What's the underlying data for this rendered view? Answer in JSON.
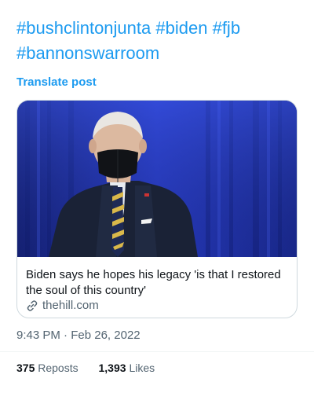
{
  "post": {
    "hashtags_line1": [
      "#bushclintonjunta",
      "#biden",
      "#fjb"
    ],
    "hashtags_line2": [
      "#bannonswarroom"
    ],
    "translate_label": "Translate post",
    "card": {
      "title": "Biden says he hopes his legacy 'is that I restored the soul of this country'",
      "domain": "thehill.com",
      "image_icon": "link-icon"
    },
    "time": "9:43 PM",
    "separator": "·",
    "date": "Feb 26, 2022",
    "stats": {
      "reposts_count": "375",
      "reposts_label": "Reposts",
      "likes_count": "1,393",
      "likes_label": "Likes"
    }
  },
  "colors": {
    "link_blue": "#1d9bf0",
    "text_secondary": "#536471",
    "text_primary": "#0f1419",
    "card_border": "#cfd9de"
  }
}
